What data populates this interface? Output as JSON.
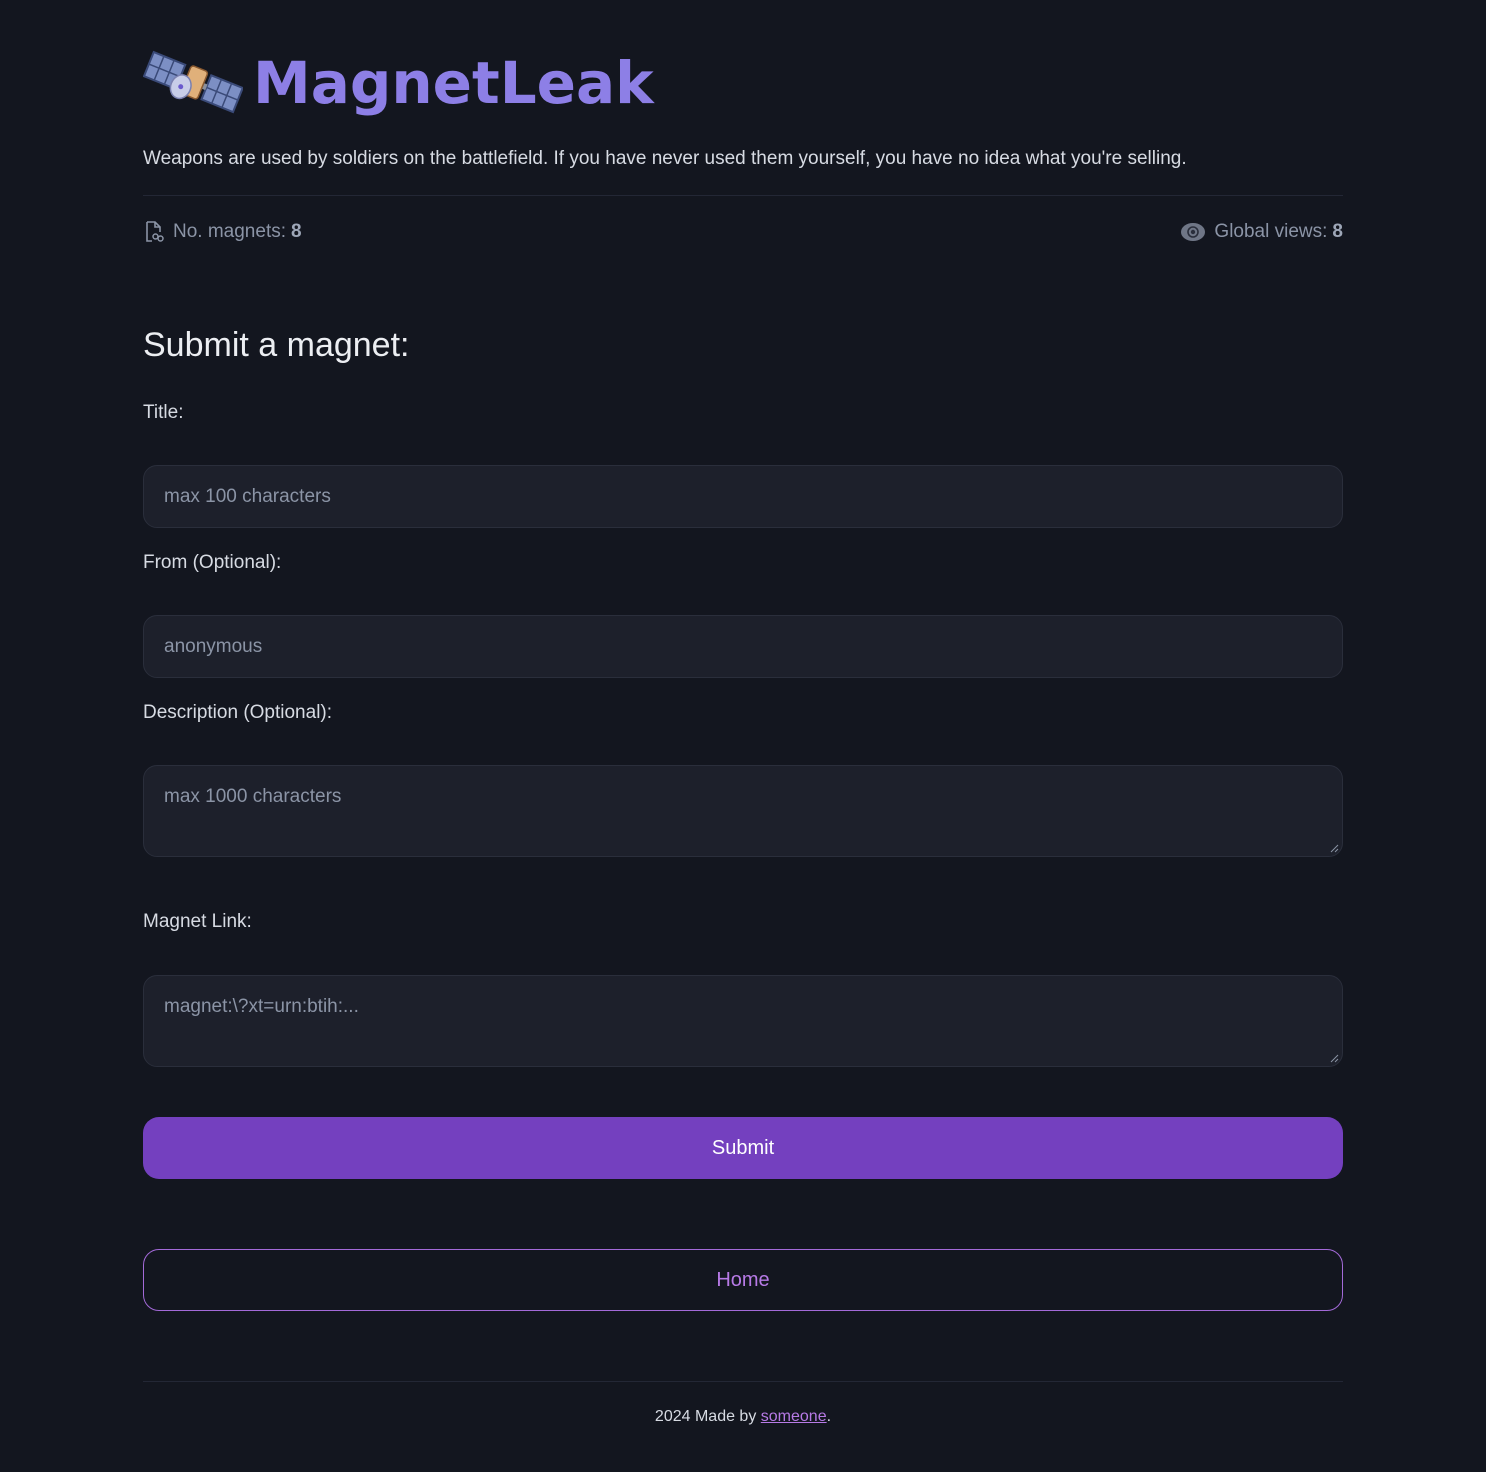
{
  "brand": {
    "name": "MagnetLeak",
    "accent": "#8d7fe6"
  },
  "tagline": "Weapons are used by soldiers on the battlefield. If you have never used them yourself, you have no idea what you're selling.",
  "stats": {
    "magnets_label": "No. magnets:",
    "magnets_value": "8",
    "views_label": "Global views:",
    "views_value": "8"
  },
  "form": {
    "title": "Submit a magnet:",
    "title_label": "Title:",
    "title_placeholder": "max 100 characters",
    "from_label": "From (Optional):",
    "from_placeholder": "anonymous",
    "description_label": "Description (Optional):",
    "description_placeholder": "max 1000 characters",
    "magnet_label": "Magnet Link:",
    "magnet_placeholder": "magnet:\\?xt=urn:btih:...",
    "submit_label": "Submit",
    "submit_color": "#7440bf"
  },
  "nav": {
    "home_label": "Home"
  },
  "footer": {
    "prefix": "2024 Made by ",
    "link": "someone",
    "suffix": "."
  },
  "icons": [
    "satellite-logo-icon",
    "file-link-icon",
    "eye-icon"
  ]
}
